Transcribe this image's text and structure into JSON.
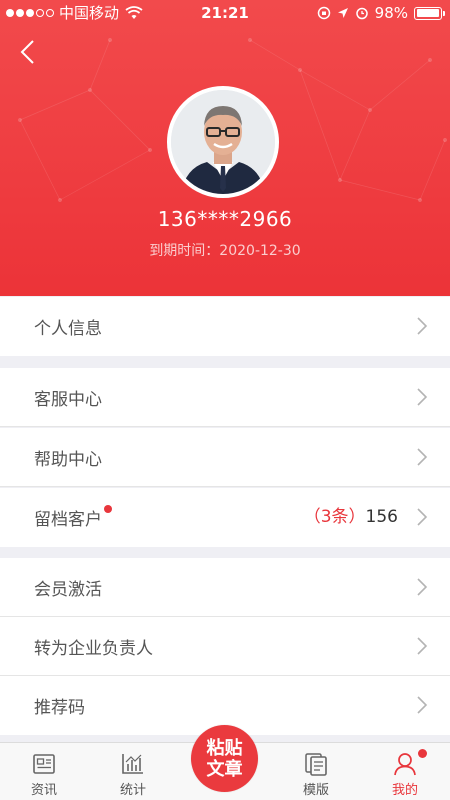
{
  "status_bar": {
    "carrier": "中国移动",
    "time": "21:21",
    "battery_text": "98%",
    "battery_level": 0.98,
    "signal_bars_filled": 3,
    "signal_bars_total": 5
  },
  "profile": {
    "phone": "136****2966",
    "expire_text": "到期时间：2020-12-30"
  },
  "menu": {
    "personal_info": "个人信息",
    "customer_service": "客服中心",
    "help_center": "帮助中心",
    "saved_clients": "留档客户",
    "saved_clients_new_paren_open": "（",
    "saved_clients_new": "3条",
    "saved_clients_new_paren_close": "）",
    "saved_clients_total": "156",
    "member_activation": "会员激活",
    "become_enterprise_owner": "转为企业负责人",
    "referral_code": "推荐码"
  },
  "tabs": {
    "news": "资讯",
    "stats": "统计",
    "paste_line1": "粘贴",
    "paste_line2": "文章",
    "templates": "模版",
    "mine": "我的"
  },
  "colors": {
    "accent": "#e8363c",
    "header_top": "#f24a4c",
    "header_bottom": "#ec3338"
  },
  "icons": [
    "back-arrow-icon",
    "wifi-icon",
    "battery-icon",
    "chevron-right-icon",
    "news-icon",
    "stats-icon",
    "templates-icon",
    "user-icon"
  ]
}
